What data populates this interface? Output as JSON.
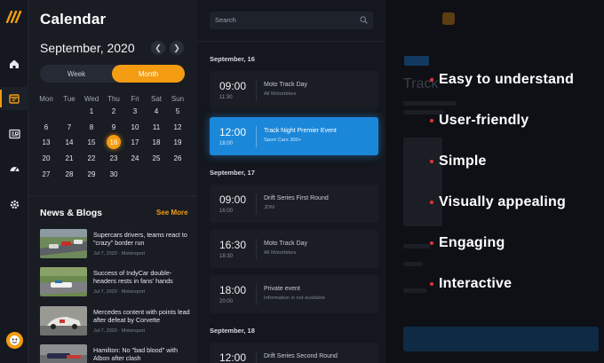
{
  "sidebar": {
    "icons": [
      "home-icon",
      "calendar-icon",
      "news-icon",
      "dashboard-icon",
      "settings-icon"
    ],
    "active": "calendar-icon",
    "accent": "#f39c12"
  },
  "calendar": {
    "title": "Calendar",
    "month_label": "September, 2020",
    "toggle": {
      "week": "Week",
      "month": "Month",
      "selected": "Month"
    },
    "weekdays": [
      "Mon",
      "Tue",
      "Wed",
      "Thu",
      "Fri",
      "Sat",
      "Sun"
    ],
    "weeks": [
      [
        "",
        "",
        "1",
        "2",
        "3",
        "4",
        "5"
      ],
      [
        "6",
        "7",
        "8",
        "9",
        "10",
        "11",
        "12"
      ],
      [
        "13",
        "14",
        "15",
        "16",
        "17",
        "18",
        "19"
      ],
      [
        "20",
        "21",
        "22",
        "23",
        "24",
        "25",
        "26"
      ],
      [
        "27",
        "28",
        "29",
        "30",
        "",
        "",
        ""
      ]
    ],
    "today": "16"
  },
  "news": {
    "heading": "News & Blogs",
    "see_more": "See More",
    "items": [
      {
        "headline": "Supercars drivers, teams react to \"crazy\" border run",
        "date": "Jul 7, 2020 · Motorsport",
        "thumb": "race-track-photo"
      },
      {
        "headline": "Success of IndyCar double-headers rests in fans' hands",
        "date": "Jul 7, 2020 · Motorsport",
        "thumb": "indycar-photo"
      },
      {
        "headline": "Mercedes content with points lead after defeat by Corvette",
        "date": "Jul 7, 2020 · Motorsport",
        "thumb": "gt-car-photo"
      },
      {
        "headline": "Hamilton: No \"bad blood\" with Albon after clash",
        "date": "",
        "thumb": "f1-photo"
      }
    ]
  },
  "events": {
    "search_placeholder": "Search",
    "sections": [
      {
        "label": "September, 16",
        "items": [
          {
            "time": "09:00",
            "end": "11:30",
            "name": "Moto Track Day",
            "sub": "All Motorbikes",
            "highlight": false
          },
          {
            "time": "12:00",
            "end": "18:00",
            "name": "Track Night Premier Event",
            "sub": "Sport Cars 300+",
            "highlight": true
          }
        ]
      },
      {
        "label": "September, 17",
        "items": [
          {
            "time": "09:00",
            "end": "16:00",
            "name": "Drift Series First Round",
            "sub": "JDM",
            "highlight": false
          },
          {
            "time": "16:30",
            "end": "18:30",
            "name": "Moto Track Day",
            "sub": "All Motorbikes",
            "highlight": false
          },
          {
            "time": "18:00",
            "end": "20:00",
            "name": "Private event",
            "sub": "Information is not available",
            "highlight": false
          }
        ]
      },
      {
        "label": "September, 18",
        "items": [
          {
            "time": "12:00",
            "end": "",
            "name": "Drift Series Second Round",
            "sub": "",
            "highlight": false
          }
        ]
      }
    ]
  },
  "detail": {
    "title": "Track"
  },
  "features": [
    "Easy to understand",
    "User-friendly",
    "Simple",
    "Visually appealing",
    "Engaging",
    "Interactive"
  ]
}
